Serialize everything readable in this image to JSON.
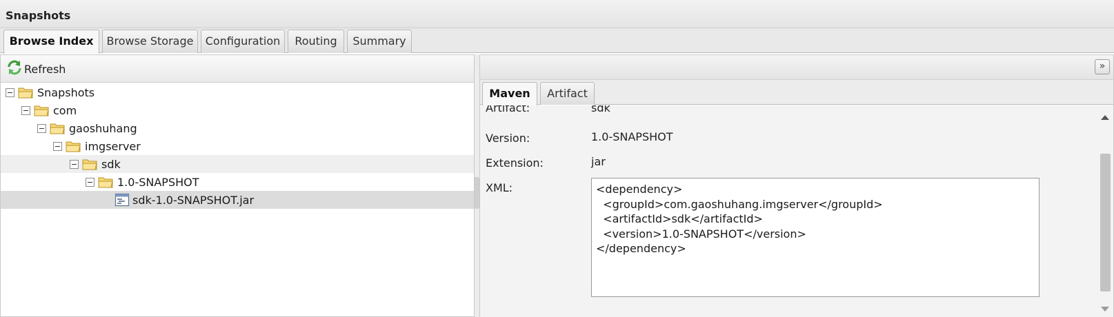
{
  "window": {
    "title": "Snapshots"
  },
  "tabs": [
    {
      "label": "Browse Index",
      "active": true
    },
    {
      "label": "Browse Storage",
      "active": false
    },
    {
      "label": "Configuration",
      "active": false
    },
    {
      "label": "Routing",
      "active": false
    },
    {
      "label": "Summary",
      "active": false
    }
  ],
  "toolbar": {
    "refresh_label": "Refresh"
  },
  "tree": [
    {
      "label": "Snapshots",
      "depth": 0,
      "kind": "folder"
    },
    {
      "label": "com",
      "depth": 1,
      "kind": "folder"
    },
    {
      "label": "gaoshuhang",
      "depth": 2,
      "kind": "folder"
    },
    {
      "label": "imgserver",
      "depth": 3,
      "kind": "folder"
    },
    {
      "label": "sdk",
      "depth": 4,
      "kind": "folder"
    },
    {
      "label": "1.0-SNAPSHOT",
      "depth": 5,
      "kind": "folder"
    },
    {
      "label": "sdk-1.0-SNAPSHOT.jar",
      "depth": 6,
      "kind": "file"
    }
  ],
  "detail_tabs": [
    {
      "label": "Maven",
      "active": true
    },
    {
      "label": "Artifact",
      "active": false
    }
  ],
  "detail": {
    "artifact_label": "Artifact:",
    "artifact_value": "sdk",
    "version_label": "Version:",
    "version_value": "1.0-SNAPSHOT",
    "extension_label": "Extension:",
    "extension_value": "jar",
    "xml_label": "XML:",
    "xml_value": "<dependency>\n  <groupId>com.gaoshuhang.imgserver</groupId>\n  <artifactId>sdk</artifactId>\n  <version>1.0-SNAPSHOT</version>\n</dependency>"
  },
  "icons": {
    "refresh": "refresh-icon",
    "folder": "folder-open-icon",
    "file": "jar-file-icon",
    "collapse": "double-chevron-right-icon"
  },
  "colors": {
    "selected_row": "#dcdcdc",
    "hover_row": "#efefef",
    "folder_fill": "#f7d774",
    "refresh_green": "#3d9b35"
  }
}
